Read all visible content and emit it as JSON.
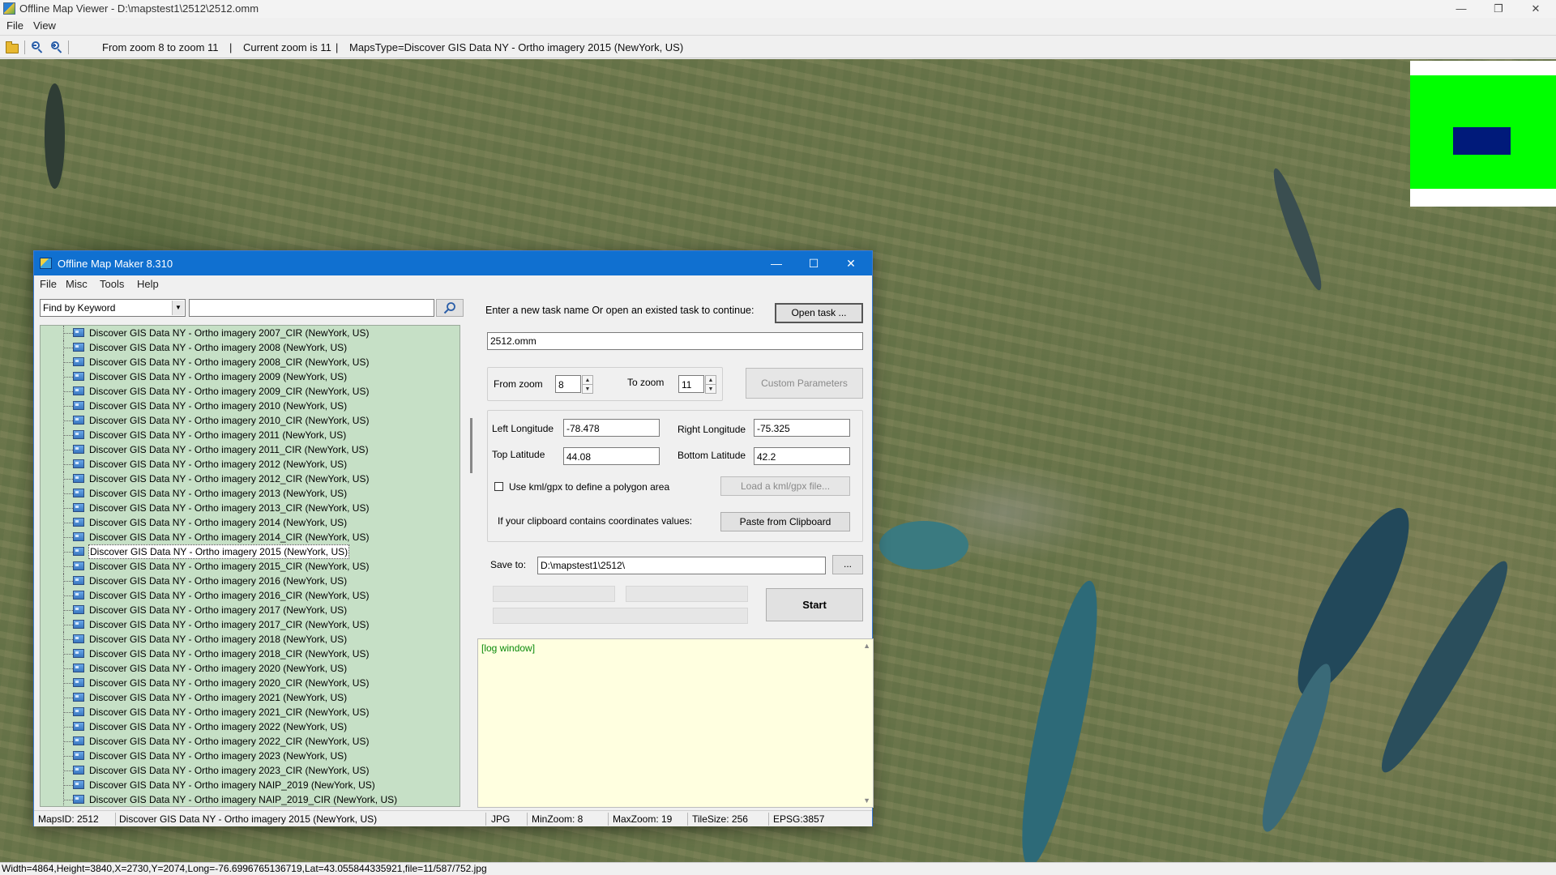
{
  "viewer": {
    "title": "Offline Map Viewer - D:\\mapstest1\\2512\\2512.omm",
    "window_controls": {
      "minimize": "—",
      "restore": "❐",
      "close": "✕"
    },
    "menu": [
      "File",
      "View"
    ],
    "toolbar": {
      "zoom_range": "From zoom 8 to zoom 11",
      "separator": "|",
      "current_zoom": "Current zoom is 11",
      "maps_type": "MapsType=Discover GIS Data NY - Ortho imagery 2015 (NewYork, US)"
    },
    "status": "Width=4864,Height=3840,X=2730,Y=2074,Long=-76.6996765136719,Lat=43.055844335921,file=11/587/752.jpg",
    "minimap_colors": {
      "frame": "#00ff00",
      "viewport": "#001a7a"
    }
  },
  "dialog": {
    "title": "Offline Map Maker 8.310",
    "window_controls": {
      "minimize": "—",
      "maximize": "☐",
      "close": "✕"
    },
    "menu": [
      "File",
      "Misc",
      "Tools",
      "Help"
    ],
    "search": {
      "mode": "Find by Keyword",
      "query": ""
    },
    "tree_items": [
      "Discover GIS Data NY - Ortho imagery 2007_CIR (NewYork, US)",
      "Discover GIS Data NY - Ortho imagery 2008 (NewYork, US)",
      "Discover GIS Data NY - Ortho imagery 2008_CIR (NewYork, US)",
      "Discover GIS Data NY - Ortho imagery 2009 (NewYork, US)",
      "Discover GIS Data NY - Ortho imagery 2009_CIR (NewYork, US)",
      "Discover GIS Data NY - Ortho imagery 2010 (NewYork, US)",
      "Discover GIS Data NY - Ortho imagery 2010_CIR (NewYork, US)",
      "Discover GIS Data NY - Ortho imagery 2011 (NewYork, US)",
      "Discover GIS Data NY - Ortho imagery 2011_CIR (NewYork, US)",
      "Discover GIS Data NY - Ortho imagery 2012 (NewYork, US)",
      "Discover GIS Data NY - Ortho imagery 2012_CIR (NewYork, US)",
      "Discover GIS Data NY - Ortho imagery 2013 (NewYork, US)",
      "Discover GIS Data NY - Ortho imagery 2013_CIR (NewYork, US)",
      "Discover GIS Data NY - Ortho imagery 2014 (NewYork, US)",
      "Discover GIS Data NY - Ortho imagery 2014_CIR (NewYork, US)",
      "Discover GIS Data NY - Ortho imagery 2015 (NewYork, US)",
      "Discover GIS Data NY - Ortho imagery 2015_CIR (NewYork, US)",
      "Discover GIS Data NY - Ortho imagery 2016 (NewYork, US)",
      "Discover GIS Data NY - Ortho imagery 2016_CIR (NewYork, US)",
      "Discover GIS Data NY - Ortho imagery 2017 (NewYork, US)",
      "Discover GIS Data NY - Ortho imagery 2017_CIR (NewYork, US)",
      "Discover GIS Data NY - Ortho imagery 2018 (NewYork, US)",
      "Discover GIS Data NY - Ortho imagery 2018_CIR (NewYork, US)",
      "Discover GIS Data NY - Ortho imagery 2020 (NewYork, US)",
      "Discover GIS Data NY - Ortho imagery 2020_CIR (NewYork, US)",
      "Discover GIS Data NY - Ortho imagery 2021 (NewYork, US)",
      "Discover GIS Data NY - Ortho imagery 2021_CIR (NewYork, US)",
      "Discover GIS Data NY - Ortho imagery 2022 (NewYork, US)",
      "Discover GIS Data NY - Ortho imagery 2022_CIR (NewYork, US)",
      "Discover GIS Data NY - Ortho imagery 2023 (NewYork, US)",
      "Discover GIS Data NY - Ortho imagery 2023_CIR (NewYork, US)",
      "Discover GIS Data NY - Ortho imagery NAIP_2019 (NewYork, US)",
      "Discover GIS Data NY - Ortho imagery NAIP_2019_CIR (NewYork, US)"
    ],
    "selected_index": 15,
    "task_prompt": "Enter a new task name Or open an existed task to continue:",
    "open_task_label": "Open task ...",
    "task_name": "2512.omm",
    "from_zoom_label": "From zoom",
    "from_zoom": "8",
    "to_zoom_label": "To zoom",
    "to_zoom": "11",
    "custom_params_label": "Custom Parameters",
    "left_lon_label": "Left Longitude",
    "left_lon": "-78.478",
    "right_lon_label": "Right Longitude",
    "right_lon": "-75.325",
    "top_lat_label": "Top Latitude",
    "top_lat": "44.08",
    "bottom_lat_label": "Bottom Latitude",
    "bottom_lat": "42.2",
    "kml_label": "Use kml/gpx to define a polygon area",
    "load_kml_label": "Load a kml/gpx file...",
    "clipboard_text": "If your clipboard contains coordinates values:",
    "paste_label": "Paste from Clipboard",
    "save_to_label": "Save to:",
    "save_to": "D:\\mapstest1\\2512\\",
    "browse_label": "...",
    "start_label": "Start",
    "log_text": "[log window]",
    "status": {
      "maps_id": "MapsID: 2512",
      "maps_name": "Discover GIS Data NY - Ortho imagery 2015 (NewYork, US)",
      "format": "JPG",
      "min_zoom": "MinZoom: 8",
      "max_zoom": "MaxZoom: 19",
      "tile_size": "TileSize: 256",
      "epsg": "EPSG:3857"
    }
  }
}
